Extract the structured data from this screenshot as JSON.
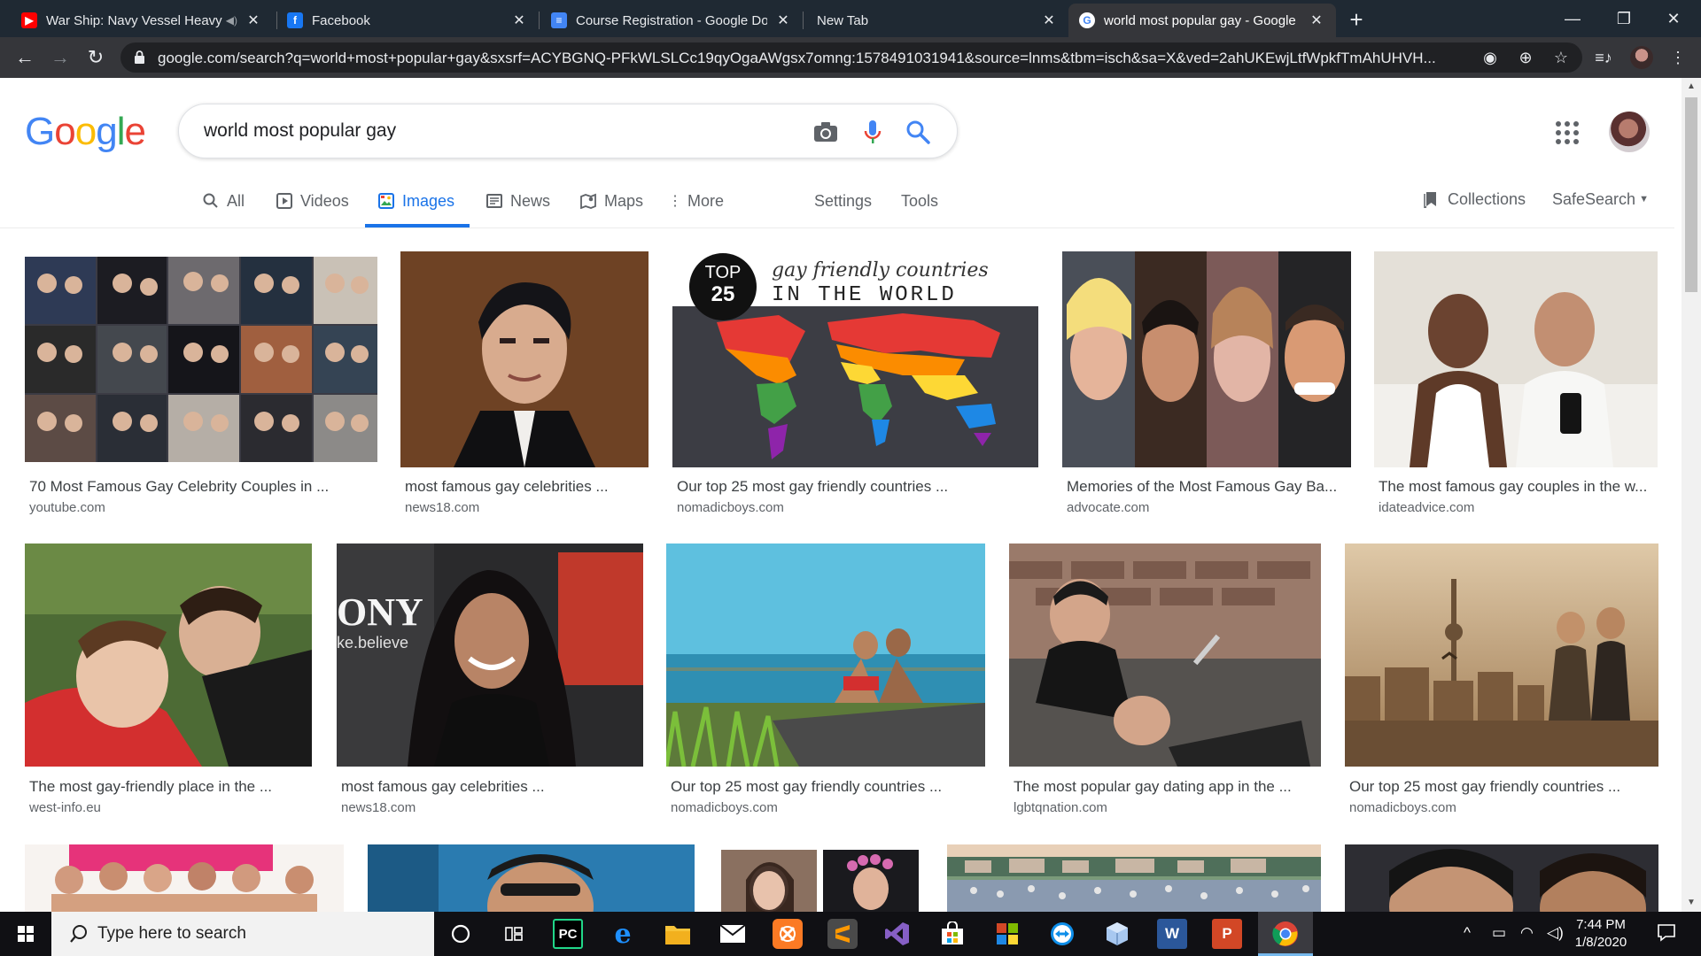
{
  "browser": {
    "tabs": [
      {
        "title": "War Ship: Navy Vessel Heavy",
        "favicon": "youtube-icon",
        "favicon_color": "#ff0000",
        "audio": true
      },
      {
        "title": "Facebook",
        "favicon": "facebook-icon",
        "favicon_color": "#1877f2"
      },
      {
        "title": "Course Registration - Google Do",
        "favicon": "google-docs-icon",
        "favicon_color": "#4285f4"
      },
      {
        "title": "New Tab",
        "favicon": "none"
      },
      {
        "title": "world most popular gay - Google",
        "favicon": "google-icon",
        "active": true
      }
    ],
    "url": "google.com/search?q=world+most+popular+gay&sxsrf=ACYBGNQ-PFkWLSLCc19qyOgaAWgsx7omng:1578491031941&source=lnms&tbm=isch&sa=X&ved=2ahUKEwjLtfWpkfTmAhUHVH..."
  },
  "google": {
    "logo": [
      "G",
      "o",
      "o",
      "g",
      "l",
      "e"
    ],
    "logo_colors": [
      "#4285f4",
      "#ea4335",
      "#fbbc05",
      "#4285f4",
      "#34a853",
      "#ea4335"
    ],
    "query": "world most popular gay",
    "tabs": [
      {
        "label": "All",
        "icon": "search-icon"
      },
      {
        "label": "Videos",
        "icon": "video-icon"
      },
      {
        "label": "Images",
        "icon": "image-icon",
        "active": true
      },
      {
        "label": "News",
        "icon": "news-icon"
      },
      {
        "label": "Maps",
        "icon": "map-icon"
      },
      {
        "label": "More",
        "icon": "more-vertical-icon"
      },
      {
        "label": "Settings"
      },
      {
        "label": "Tools"
      }
    ],
    "collections": "Collections",
    "safesearch": "SafeSearch",
    "accent": "#1a73e8"
  },
  "results": [
    {
      "title": "70 Most Famous Gay Celebrity Couples in ...",
      "source": "youtube.com",
      "bg": "#3b3b44"
    },
    {
      "title": "most famous gay celebrities ...",
      "source": "news18.com",
      "bg": "#7a4a28"
    },
    {
      "title": "Our top 25 most gay friendly countries ...",
      "source": "nomadicboys.com",
      "bg": "#3c3d44",
      "overlay": {
        "badge_top": "TOP",
        "badge_num": "25",
        "script": "gay friendly countries",
        "caps": "IN THE WORLD"
      }
    },
    {
      "title": "Memories of the Most Famous Gay Ba...",
      "source": "advocate.com",
      "bg": "#8a5f4c"
    },
    {
      "title": "The most famous gay couples in the w...",
      "source": "idateadvice.com",
      "bg": "#d8d4cc"
    },
    {
      "title": "The most gay-friendly place in the ...",
      "source": "west-info.eu",
      "bg": "#4e6a3a"
    },
    {
      "title": "most famous gay celebrities ...",
      "source": "news18.com",
      "bg": "#2b2526",
      "overlay": {
        "sign_text": "ONY",
        "sign_sub": "ke.believe"
      }
    },
    {
      "title": "Our top 25 most gay friendly countries ...",
      "source": "nomadicboys.com",
      "bg": "#4fb3d6"
    },
    {
      "title": "The most popular gay dating app in the ...",
      "source": "lgbtqnation.com",
      "bg": "#6b6762"
    },
    {
      "title": "Our top 25 most gay friendly countries ...",
      "source": "nomadicboys.com",
      "bg": "#b8936a"
    },
    {
      "bg": "#e85a8a"
    },
    {
      "bg": "#1e6aa0"
    },
    {
      "bg": "#5a4a40"
    },
    {
      "bg": "#6a8a6a"
    },
    {
      "bg": "#3a3a3a"
    }
  ],
  "taskbar": {
    "search_placeholder": "Type here to search",
    "apps": [
      {
        "icon": "cortana-icon"
      },
      {
        "icon": "task-view-icon"
      },
      {
        "icon": "pycharm-icon",
        "label": "PC",
        "color": "#21d789"
      },
      {
        "icon": "edge-icon",
        "label": "e",
        "color": "#0078d7"
      },
      {
        "icon": "file-explorer-icon",
        "color": "#f8c43a"
      },
      {
        "icon": "mail-icon",
        "color": "#ffffff"
      },
      {
        "icon": "xampp-icon",
        "color": "#fb7a24"
      },
      {
        "icon": "sublime-text-icon",
        "color": "#ff9800"
      },
      {
        "icon": "visual-studio-icon",
        "color": "#865fc5"
      },
      {
        "icon": "store-icon",
        "color": "#ffffff"
      },
      {
        "icon": "winrar-icon",
        "color": "#d24726"
      },
      {
        "icon": "teamviewer-icon",
        "color": "#0e8ee9"
      },
      {
        "icon": "virtualbox-icon",
        "color": "#a8c8f0"
      },
      {
        "icon": "word-icon",
        "label": "W",
        "color": "#2b579a"
      },
      {
        "icon": "powerpoint-icon",
        "label": "P",
        "color": "#d24726"
      },
      {
        "icon": "chrome-icon",
        "active": true
      }
    ],
    "time": "7:44 PM",
    "date": "1/8/2020"
  }
}
